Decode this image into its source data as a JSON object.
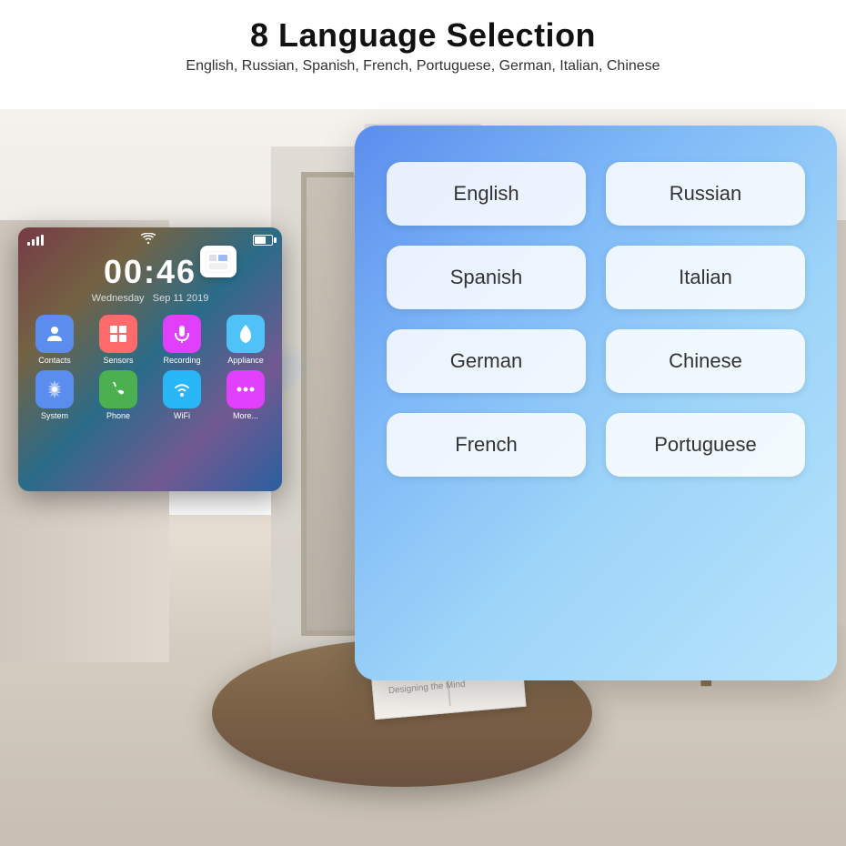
{
  "header": {
    "title": "8 Language Selection",
    "subtitle": "English, Russian, Spanish, French, Portuguese, German, Italian, Chinese"
  },
  "device": {
    "time": "00:46",
    "day": "Wednesday",
    "date": "Sep 11 2019",
    "apps": [
      {
        "label": "Contacts",
        "color": "#5B8DEE",
        "icon": "👤"
      },
      {
        "label": "Sensors",
        "color": "#FF6B6B",
        "icon": "⊞"
      },
      {
        "label": "Recording",
        "color": "#E040FB",
        "icon": "🎙"
      },
      {
        "label": "Appliance",
        "color": "#4FC3F7",
        "icon": "☁"
      },
      {
        "label": "System",
        "color": "#5B8DEE",
        "icon": "⚙"
      },
      {
        "label": "Phone",
        "color": "#4CAF50",
        "icon": "📞"
      },
      {
        "label": "WiFi",
        "color": "#29B6F6",
        "icon": "📶"
      },
      {
        "label": "More...",
        "color": "#E040FB",
        "icon": "•••"
      }
    ]
  },
  "language_panel": {
    "languages": [
      {
        "id": "english",
        "label": "English"
      },
      {
        "id": "russian",
        "label": "Russian"
      },
      {
        "id": "spanish",
        "label": "Spanish"
      },
      {
        "id": "italian",
        "label": "Italian"
      },
      {
        "id": "german",
        "label": "German"
      },
      {
        "id": "chinese",
        "label": "Chinese"
      },
      {
        "id": "french",
        "label": "French"
      },
      {
        "id": "portuguese",
        "label": "Portuguese"
      }
    ]
  }
}
